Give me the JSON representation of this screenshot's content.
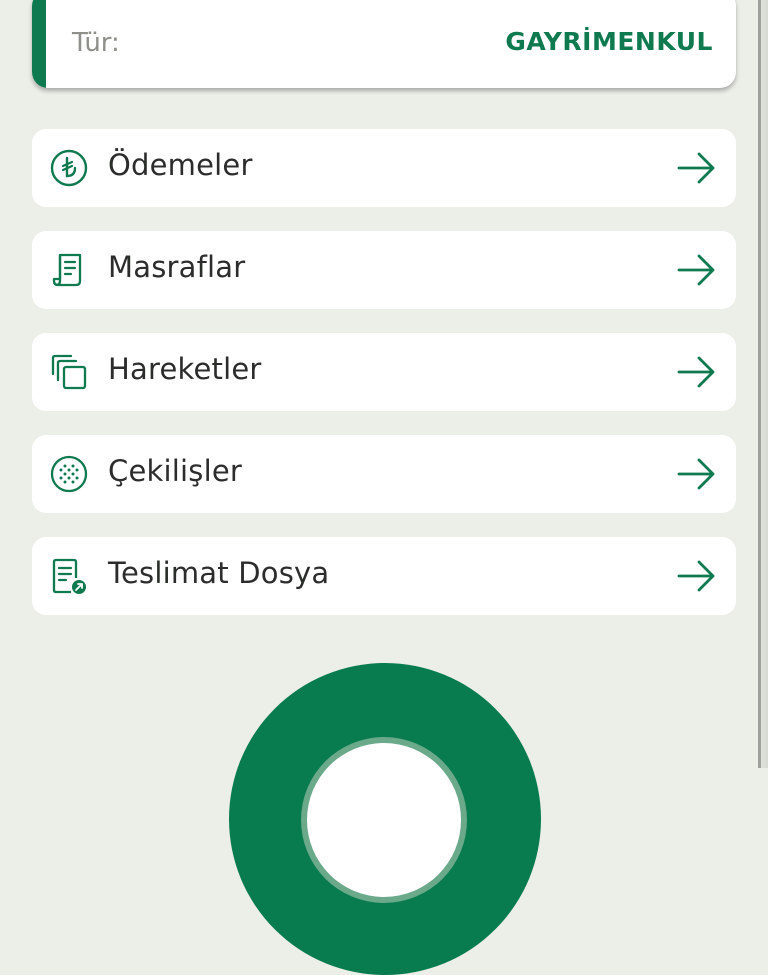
{
  "details": {
    "type_label": "Tür:",
    "type_value": "GAYRİMENKUL"
  },
  "menu": {
    "items": [
      {
        "label": "Ödemeler",
        "icon": "lira-circle-icon"
      },
      {
        "label": "Masraflar",
        "icon": "receipt-icon"
      },
      {
        "label": "Hareketler",
        "icon": "copy-stack-icon"
      },
      {
        "label": "Çekilişler",
        "icon": "lottery-ball-icon"
      },
      {
        "label": "Teslimat Dosya",
        "icon": "delivery-document-icon"
      }
    ],
    "arrow_icon": "arrow-right-icon"
  },
  "colors": {
    "brand_green": "#0f7a4f",
    "background": "#eceee8",
    "text_dark": "#2b2d2b",
    "text_muted": "#8d8f8a"
  }
}
